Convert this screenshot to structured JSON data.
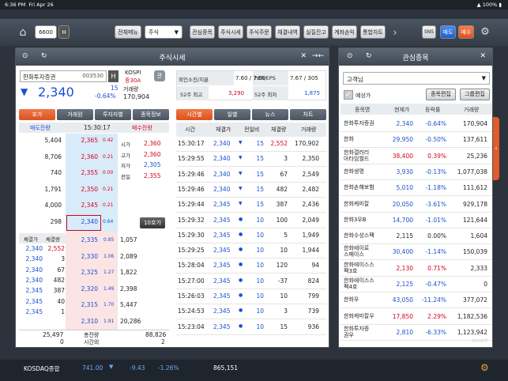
{
  "status": {
    "time": "6:36 PM",
    "date": "Fri Apr 26",
    "battery": "100%"
  },
  "toolbar": {
    "screen_no": "6600",
    "h_label": "H",
    "menu": "전체메뉴",
    "type": "주식",
    "buttons": [
      "관심종목",
      "주식시세",
      "주식주문",
      "체결내역",
      "실질잔고",
      "계좌손익",
      "통합차트"
    ],
    "sns": "SNS",
    "buy": "매도",
    "sell": "매수"
  },
  "left": {
    "title": "주식시세",
    "stock_name": "한화투자증권",
    "code": "003530",
    "h": "H",
    "market": "KOSPI",
    "margin": "증30A",
    "gwan": "관",
    "price": "2,340",
    "change": "15",
    "pct": "-0.64%",
    "vol_label": "거래량",
    "volume": "170,904",
    "info": [
      {
        "label": "외인소진/지분",
        "value": "7.60 / 7.60"
      },
      {
        "label": "PER/EPS",
        "value": "7.67 / 305"
      },
      {
        "label": "52주 최고",
        "value": "3,290"
      },
      {
        "label": "52주 최저",
        "value": "1,875"
      }
    ],
    "tabs": [
      "호가",
      "거래원",
      "투자자별",
      "종목정보"
    ],
    "right_tabs": [
      "시간별",
      "일별",
      "뉴스",
      "차트"
    ],
    "hoga_head": {
      "sell": "매도잔량",
      "time": "15:30:17",
      "buy": "매수잔량"
    },
    "asks": [
      {
        "qty": "5,404",
        "price": "2,365",
        "pct": "0.42"
      },
      {
        "qty": "8,706",
        "price": "2,360",
        "pct": "0.21"
      },
      {
        "qty": "740",
        "price": "2,355",
        "pct": "0.00"
      },
      {
        "qty": "1,791",
        "price": "2,350",
        "pct": "0.21"
      },
      {
        "qty": "4,000",
        "price": "2,345",
        "pct": "0.21"
      },
      {
        "qty": "298",
        "price": "2,340",
        "pct": "0.64"
      }
    ],
    "ohlc": [
      {
        "l": "시가",
        "v": "2,360"
      },
      {
        "l": "고가",
        "v": "2,360"
      },
      {
        "l": "저가",
        "v": "2,305"
      },
      {
        "l": "전일",
        "v": "2,355"
      }
    ],
    "ten_btn": "10호가",
    "bids": [
      {
        "price": "2,335",
        "pct": "0.85",
        "qty": "1,057"
      },
      {
        "price": "2,330",
        "pct": "1.06",
        "qty": "2,089"
      },
      {
        "price": "2,325",
        "pct": "1.27",
        "qty": "1,822"
      },
      {
        "price": "2,320",
        "pct": "1.49",
        "qty": "2,398"
      },
      {
        "price": "2,315",
        "pct": "1.70",
        "qty": "5,447"
      },
      {
        "price": "2,310",
        "pct": "1.91",
        "qty": "20,286"
      }
    ],
    "trade_head": [
      "체결가",
      "체결량"
    ],
    "trades": [
      {
        "p": "2,340",
        "q": "2,552"
      },
      {
        "p": "2,340",
        "q": "3"
      },
      {
        "p": "2,340",
        "q": "67"
      },
      {
        "p": "2,340",
        "q": "482"
      },
      {
        "p": "2,345",
        "q": "387"
      },
      {
        "p": "2,345",
        "q": "40"
      },
      {
        "p": "2,345",
        "q": "1"
      }
    ],
    "total": {
      "sell": "25,497",
      "label": "총잔량",
      "buy": "88,826",
      "zero": "0",
      "time_label": "시간외",
      "two": "2"
    },
    "tick_head": [
      "시간",
      "체결가",
      "전일비",
      "체결량",
      "거래량"
    ],
    "ticks": [
      {
        "t": "15:30:17",
        "p": "2,340",
        "d": "15",
        "q": "2,552",
        "v": "170,902"
      },
      {
        "t": "15:29:55",
        "p": "2,340",
        "d": "15",
        "q": "3",
        "v": "2,350"
      },
      {
        "t": "15:29:46",
        "p": "2,340",
        "d": "15",
        "q": "67",
        "v": "2,549"
      },
      {
        "t": "15:29:46",
        "p": "2,340",
        "d": "15",
        "q": "482",
        "v": "2,482"
      },
      {
        "t": "15:29:44",
        "p": "2,345",
        "d": "15",
        "q": "387",
        "v": "2,436"
      },
      {
        "t": "15:29:32",
        "p": "2,345",
        "d": "10",
        "q": "100",
        "v": "2,049"
      },
      {
        "t": "15:29:30",
        "p": "2,345",
        "d": "10",
        "q": "5",
        "v": "1,949"
      },
      {
        "t": "15:29:25",
        "p": "2,345",
        "d": "10",
        "q": "10",
        "v": "1,944"
      },
      {
        "t": "15:28:04",
        "p": "2,345",
        "d": "10",
        "q": "120",
        "v": "94"
      },
      {
        "t": "15:27:00",
        "p": "2,345",
        "d": "10",
        "q": "-37",
        "v": "824"
      },
      {
        "t": "15:26:03",
        "p": "2,345",
        "d": "10",
        "q": "10",
        "v": "799"
      },
      {
        "t": "15:24:53",
        "p": "2,345",
        "d": "10",
        "q": "3",
        "v": "739"
      },
      {
        "t": "15:23:04",
        "p": "2,345",
        "d": "10",
        "q": "15",
        "v": "936"
      }
    ]
  },
  "right": {
    "title": "관심종목",
    "group": "고객님",
    "yesang": "예상가",
    "btn1": "종목편집",
    "btn2": "그룹편집",
    "head": [
      "종목명",
      "현재가",
      "등락률",
      "거래량"
    ],
    "rows": [
      {
        "n": "한화투자증권",
        "p": "2,340",
        "r": "-0.64%",
        "v": "170,904",
        "c": "b"
      },
      {
        "n": "한화",
        "p": "29,950",
        "r": "-0.50%",
        "v": "137,611",
        "c": "b"
      },
      {
        "n": "한화갤러리\n아타임월드",
        "p": "38,400",
        "r": "0.39%",
        "v": "25,236",
        "c": "r"
      },
      {
        "n": "한화생명",
        "p": "3,930",
        "r": "-0.13%",
        "v": "1,077,038",
        "c": "b"
      },
      {
        "n": "한화손해보험",
        "p": "5,010",
        "r": "-1.18%",
        "v": "111,612",
        "c": "b"
      },
      {
        "n": "한화케미칼",
        "p": "20,050",
        "r": "-3.61%",
        "v": "929,178",
        "c": "b"
      },
      {
        "n": "한화3우B",
        "p": "14,700",
        "r": "-1.01%",
        "v": "121,644",
        "c": "b"
      },
      {
        "n": "한화수성스팩",
        "p": "2,115",
        "r": "0.00%",
        "v": "1,604",
        "c": "k"
      },
      {
        "n": "한화에이로\n스페이스",
        "p": "30,400",
        "r": "-1.14%",
        "v": "150,039",
        "c": "b"
      },
      {
        "n": "한화에이스스\n팩3호",
        "p": "2,130",
        "r": "0.71%",
        "v": "2,333",
        "c": "r"
      },
      {
        "n": "한화에이스스\n팩4호",
        "p": "2,125",
        "r": "-0.47%",
        "v": "0",
        "c": "b"
      },
      {
        "n": "한화우",
        "p": "43,050",
        "r": "-11.24%",
        "v": "377,072",
        "c": "b"
      },
      {
        "n": "한화케미칼우",
        "p": "17,850",
        "r": "2.29%",
        "v": "1,182,536",
        "c": "r"
      },
      {
        "n": "한화투자증\n권우",
        "p": "2,810",
        "r": "-6.33%",
        "v": "1,123,942",
        "c": "b"
      }
    ],
    "watermark": "smart"
  },
  "bottom": {
    "index": "KOSDAQ종합",
    "value": "741.00",
    "change": "-9.43",
    "pct": "-1.26%",
    "vol": "865,151"
  }
}
